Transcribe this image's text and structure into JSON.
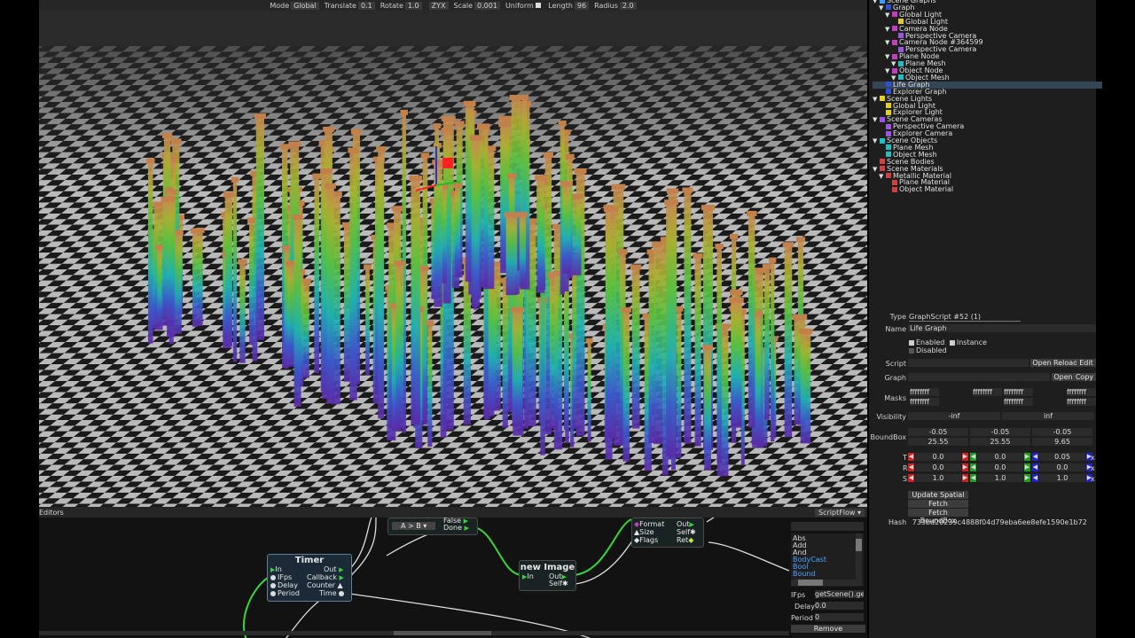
{
  "toolbar": {
    "mode_label": "Mode",
    "mode_value": "Global",
    "translate_label": "Translate",
    "translate_value": "0.1",
    "rotate_label": "Rotate",
    "rotate_value": "1.0",
    "order_value": "ZYX",
    "scale_label": "Scale",
    "scale_value": "0.001",
    "uniform_label": "Uniform",
    "length_label": "Length",
    "length_value": "96",
    "radius_label": "Radius",
    "radius_value": "2.0"
  },
  "tree": {
    "items": [
      {
        "label": "Scene Graphs",
        "color": "#3aa0ff"
      },
      {
        "label": "Graph",
        "color": "#2b4fd8"
      },
      {
        "label": "Global Light",
        "color": "#c040c0"
      },
      {
        "label": "Global Light",
        "color": "#e0d020"
      },
      {
        "label": "Camera Node",
        "color": "#c040c0"
      },
      {
        "label": "Perspective Camera",
        "color": "#9b55e0"
      },
      {
        "label": "Camera Node #364599",
        "color": "#c040c0"
      },
      {
        "label": "Perspective Camera",
        "color": "#9b55e0"
      },
      {
        "label": "Plane Node",
        "color": "#c040c0"
      },
      {
        "label": "Plane Mesh",
        "color": "#20c0c0"
      },
      {
        "label": "Object Node",
        "color": "#c040c0"
      },
      {
        "label": "Object Mesh",
        "color": "#20c0c0"
      },
      {
        "label": "Life Graph",
        "color": "#2b4fd8"
      },
      {
        "label": "Explorer Graph",
        "color": "#2b4fd8"
      },
      {
        "label": "Scene Lights",
        "color": "#e0d020"
      },
      {
        "label": "Global Light",
        "color": "#e0d020"
      },
      {
        "label": "Explorer Light",
        "color": "#e0d020"
      },
      {
        "label": "Scene Cameras",
        "color": "#9b55e0"
      },
      {
        "label": "Perspective Camera",
        "color": "#9b55e0"
      },
      {
        "label": "Explorer Camera",
        "color": "#9b55e0"
      },
      {
        "label": "Scene Objects",
        "color": "#20c0c0"
      },
      {
        "label": "Plane Mesh",
        "color": "#20c0c0"
      },
      {
        "label": "Object Mesh",
        "color": "#20c0c0"
      },
      {
        "label": "Scene Bodies",
        "color": "#d04040"
      },
      {
        "label": "Scene Materials",
        "color": "#d04040"
      },
      {
        "label": "Metallic Material",
        "color": "#d04040"
      },
      {
        "label": "Plane Material",
        "color": "#d04040"
      },
      {
        "label": "Object Material",
        "color": "#d04040"
      }
    ]
  },
  "props": {
    "type_label": "Type",
    "type_value": "GraphScript #52 (1)",
    "name_label": "Name",
    "name_value": "Life Graph",
    "enabled_label": "Enabled",
    "instance_label": "Instance",
    "disabled_label": "Disabled",
    "script_label": "Script",
    "open_label": "Open",
    "reload_label": "Reload",
    "edit_label": "Edit",
    "graph_label": "Graph",
    "copy_label": "Copy",
    "masks_label": "Masks",
    "mask_value": "ffffffff",
    "visibility_label": "Visibility",
    "vis_min": "-inf",
    "vis_max": "inf",
    "boundbox_label": "BoundBox",
    "bb_min": [
      "-0.05",
      "-0.05",
      "-0.05"
    ],
    "bb_max": [
      "25.55",
      "25.55",
      "9.65"
    ],
    "t_label": "T",
    "r_label": "R",
    "s_label": "S",
    "t_values": [
      "0.0",
      "0.0",
      "0.05"
    ],
    "r_values": [
      "0.0",
      "0.0",
      "0.0"
    ],
    "s_values": [
      "1.0",
      "1.0",
      "1.0"
    ],
    "x_label": "x",
    "update_spatial": "Update Spatial",
    "fetch_transforms": "Fetch Transforms",
    "fetch_boundbox": "Fetch BoundBox",
    "hash_label": "Hash",
    "hash_value": "733bd20239c4888f04d79eba6ee8efe1590e1b72"
  },
  "editors": {
    "title": "Editors",
    "flow_select": "ScriptFlow",
    "compare_value": "A > B",
    "false_label": "False",
    "done_label": "Done",
    "timer": {
      "title": "Timer",
      "in": "In",
      "ifps": "IFps",
      "delay": "Delay",
      "period": "Period",
      "out": "Out",
      "callback": "Callback",
      "counter": "Counter",
      "time": "Time"
    },
    "new_image": {
      "title": "new Image",
      "in": "In",
      "out": "Out",
      "self": "Self"
    },
    "image_node": {
      "format": "Format",
      "size": "Size",
      "flags": "Flags",
      "out": "Out",
      "self": "Self",
      "ret": "Ret"
    },
    "list": [
      "Abs",
      "Add",
      "And",
      "BodyCast",
      "Bool",
      "Bound"
    ],
    "list_colors": [
      "#d8d8d8",
      "#d8d8d8",
      "#d8d8d8",
      "#4fa0ff",
      "#4fa0ff",
      "#4fa0ff"
    ],
    "ifps_label": "IFps",
    "ifps_value": "getScene().get",
    "delay_label": "Delay",
    "delay_value": "0.0",
    "period_label": "Period",
    "period_value": "0",
    "remove_label": "Remove"
  }
}
